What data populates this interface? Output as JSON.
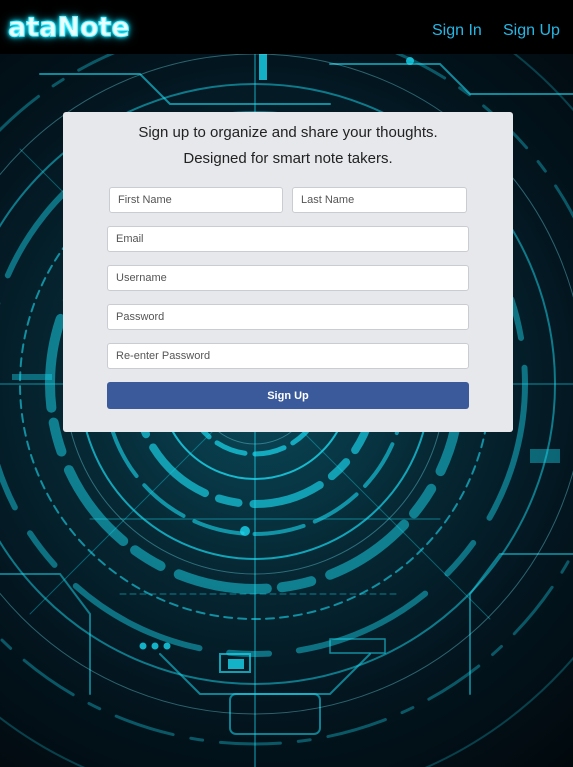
{
  "brand": {
    "logo_text": "ataNote"
  },
  "nav": {
    "sign_in": "Sign In",
    "sign_up": "Sign Up"
  },
  "signup_card": {
    "tagline_line1": "Sign up to organize and share your thoughts.",
    "tagline_line2": "Designed for smart note takers.",
    "fields": {
      "first_name": {
        "placeholder": "First Name",
        "value": ""
      },
      "last_name": {
        "placeholder": "Last Name",
        "value": ""
      },
      "email": {
        "placeholder": "Email",
        "value": ""
      },
      "username": {
        "placeholder": "Username",
        "value": ""
      },
      "password": {
        "placeholder": "Password",
        "value": ""
      },
      "reenter_password": {
        "placeholder": "Re-enter Password",
        "value": ""
      }
    },
    "submit_label": "Sign Up"
  },
  "colors": {
    "navbar_bg": "#000000",
    "nav_link": "#25b8e6",
    "logo_glow": "#18e5ff",
    "card_bg": "#e7e8ec",
    "button_bg": "#3a5a9b",
    "background_accent": "#1ad9f0"
  }
}
